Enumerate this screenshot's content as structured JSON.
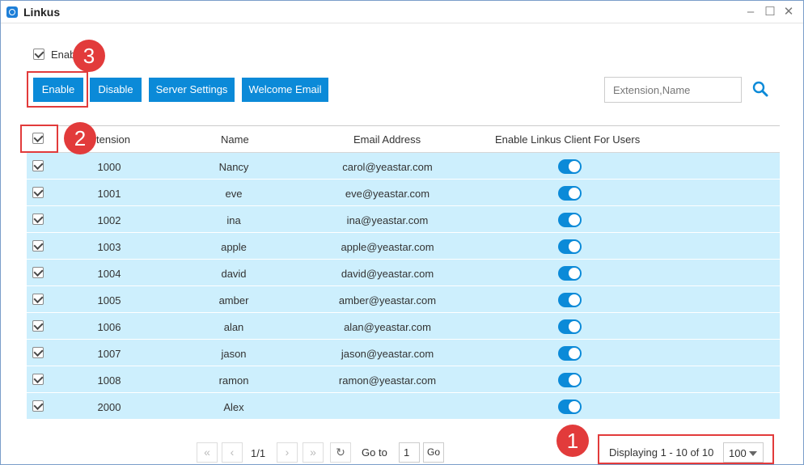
{
  "window": {
    "title": "Linkus",
    "icon": "linkus-app-icon",
    "controls": {
      "minimize": "–",
      "maximize": "☐",
      "close": "✕"
    }
  },
  "enable_option": {
    "label": "Enab"
  },
  "toolbar": {
    "enable_label": "Enable",
    "disable_label": "Disable",
    "server_settings_label": "Server Settings",
    "welcome_email_label": "Welcome Email",
    "accent_color": "#0b8ad8"
  },
  "search": {
    "placeholder": "Extension,Name",
    "icon": "search-icon"
  },
  "table": {
    "headers": {
      "extension": "tension",
      "name": "Name",
      "email": "Email Address",
      "linkus": "Enable Linkus Client For Users"
    },
    "row_color": "#cdeffd",
    "rows": [
      {
        "extension": "1000",
        "name": "Nancy",
        "email": "carol@yeastar.com",
        "selected": true,
        "enabled": true
      },
      {
        "extension": "1001",
        "name": "eve",
        "email": "eve@yeastar.com",
        "selected": true,
        "enabled": true
      },
      {
        "extension": "1002",
        "name": "ina",
        "email": "ina@yeastar.com",
        "selected": true,
        "enabled": true
      },
      {
        "extension": "1003",
        "name": "apple",
        "email": "apple@yeastar.com",
        "selected": true,
        "enabled": true
      },
      {
        "extension": "1004",
        "name": "david",
        "email": "david@yeastar.com",
        "selected": true,
        "enabled": true
      },
      {
        "extension": "1005",
        "name": "amber",
        "email": "amber@yeastar.com",
        "selected": true,
        "enabled": true
      },
      {
        "extension": "1006",
        "name": "alan",
        "email": "alan@yeastar.com",
        "selected": true,
        "enabled": true
      },
      {
        "extension": "1007",
        "name": "jason",
        "email": "jason@yeastar.com",
        "selected": true,
        "enabled": true
      },
      {
        "extension": "1008",
        "name": "ramon",
        "email": "ramon@yeastar.com",
        "selected": true,
        "enabled": true
      },
      {
        "extension": "2000",
        "name": "Alex",
        "email": "",
        "selected": true,
        "enabled": true
      }
    ]
  },
  "pager": {
    "first": "«",
    "prev": "‹",
    "page_info": "1/1",
    "next": "›",
    "last": "»",
    "refresh": "↻",
    "goto_label": "Go to",
    "goto_value": "1",
    "go_label": "Go",
    "display_info": "Displaying 1 - 10 of 10",
    "per_page": "100"
  },
  "annotations": {
    "badge_1": "1",
    "badge_2": "2",
    "badge_3": "3",
    "color": "#e23b3b"
  }
}
